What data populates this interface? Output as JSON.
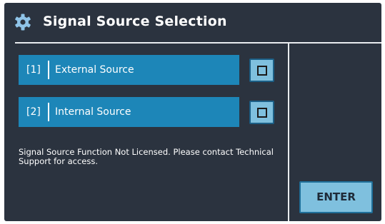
{
  "header": {
    "title": "Signal Source Selection",
    "icon": "gear-icon"
  },
  "options": [
    {
      "number": "[1]",
      "label": "External Source",
      "checked": false
    },
    {
      "number": "[2]",
      "label": "Internal Source",
      "checked": false
    }
  ],
  "notice": "Signal Source Function Not Licensed. Please contact Technical Support for access.",
  "buttons": {
    "enter_label": "ENTER"
  },
  "colors": {
    "panel_background": "#2b333f",
    "option_bar": "#1d86b8",
    "button_face": "#7fc0de",
    "text": "#ffffff"
  }
}
